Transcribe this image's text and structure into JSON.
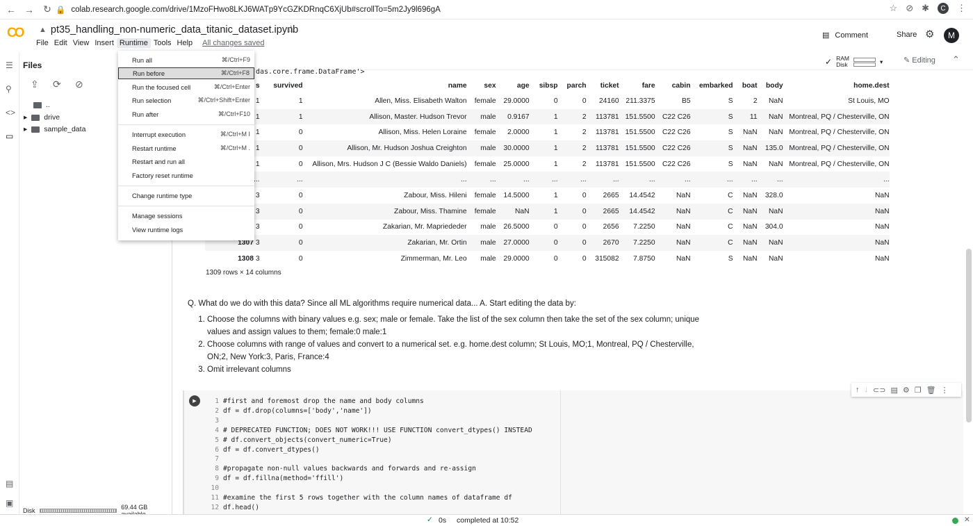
{
  "browser": {
    "url": "colab.research.google.com/drive/1MzoFHwo8LKJ6WATp9YcGZKDRnqC6XjUb#scrollTo=5m2Jy9l696gA",
    "profile_initial": "C"
  },
  "app": {
    "logo": "CO",
    "title": "pt35_handling_non-numeric_data_titanic_dataset.ipynb",
    "menu": [
      "File",
      "Edit",
      "View",
      "Insert",
      "Runtime",
      "Tools",
      "Help"
    ],
    "saved_status": "All changes saved",
    "comment_label": "Comment",
    "share_label": "Share",
    "user_initial": "M"
  },
  "sidebar": {
    "title": "Files",
    "tree": [
      {
        "name": ".."
      },
      {
        "name": "drive"
      },
      {
        "name": "sample_data"
      }
    ],
    "disk_label": "Disk",
    "disk_available": "69.44 GB available"
  },
  "resources": {
    "ram": "RAM",
    "disk": "Disk",
    "mode": "Editing"
  },
  "runtime_menu": [
    {
      "label": "Run all",
      "shortcut": "⌘/Ctrl+F9"
    },
    {
      "label": "Run before",
      "shortcut": "⌘/Ctrl+F8"
    },
    {
      "label": "Run the focused cell",
      "shortcut": "⌘/Ctrl+Enter"
    },
    {
      "label": "Run selection",
      "shortcut": "⌘/Ctrl+Shift+Enter"
    },
    {
      "label": "Run after",
      "shortcut": "⌘/Ctrl+F10"
    },
    {
      "label": "Interrupt execution",
      "shortcut": "⌘/Ctrl+M I"
    },
    {
      "label": "Restart runtime",
      "shortcut": "⌘/Ctrl+M ."
    },
    {
      "label": "Restart and run all",
      "shortcut": ""
    },
    {
      "label": "Factory reset runtime",
      "shortcut": ""
    },
    {
      "label": "Change runtime type",
      "shortcut": ""
    },
    {
      "label": "Manage sessions",
      "shortcut": ""
    },
    {
      "label": "View runtime logs",
      "shortcut": ""
    }
  ],
  "output": {
    "type_line": "das.core.frame.DataFrame'>",
    "columns": [
      "",
      "s",
      "survived",
      "name",
      "sex",
      "age",
      "sibsp",
      "parch",
      "ticket",
      "fare",
      "cabin",
      "embarked",
      "boat",
      "body",
      "home.dest"
    ],
    "rows": [
      [
        "",
        "1",
        "1",
        "Allen, Miss. Elisabeth Walton",
        "female",
        "29.0000",
        "0",
        "0",
        "24160",
        "211.3375",
        "B5",
        "S",
        "2",
        "NaN",
        "St Louis, MO"
      ],
      [
        "",
        "1",
        "1",
        "Allison, Master. Hudson Trevor",
        "male",
        "0.9167",
        "1",
        "2",
        "113781",
        "151.5500",
        "C22 C26",
        "S",
        "11",
        "NaN",
        "Montreal, PQ / Chesterville, ON"
      ],
      [
        "",
        "1",
        "0",
        "Allison, Miss. Helen Loraine",
        "female",
        "2.0000",
        "1",
        "2",
        "113781",
        "151.5500",
        "C22 C26",
        "S",
        "NaN",
        "NaN",
        "Montreal, PQ / Chesterville, ON"
      ],
      [
        "",
        "1",
        "0",
        "Allison, Mr. Hudson Joshua Creighton",
        "male",
        "30.0000",
        "1",
        "2",
        "113781",
        "151.5500",
        "C22 C26",
        "S",
        "NaN",
        "135.0",
        "Montreal, PQ / Chesterville, ON"
      ],
      [
        "",
        "1",
        "0",
        "Allison, Mrs. Hudson J C (Bessie Waldo Daniels)",
        "female",
        "25.0000",
        "1",
        "2",
        "113781",
        "151.5500",
        "C22 C26",
        "S",
        "NaN",
        "NaN",
        "Montreal, PQ / Chesterville, ON"
      ],
      [
        "",
        "...",
        "...",
        "...",
        "...",
        "...",
        "...",
        "...",
        "...",
        "...",
        "...",
        "...",
        "...",
        "...",
        "..."
      ],
      [
        "",
        "3",
        "0",
        "Zabour, Miss. Hileni",
        "female",
        "14.5000",
        "1",
        "0",
        "2665",
        "14.4542",
        "NaN",
        "C",
        "NaN",
        "328.0",
        "NaN"
      ],
      [
        "",
        "3",
        "0",
        "Zabour, Miss. Thamine",
        "female",
        "NaN",
        "1",
        "0",
        "2665",
        "14.4542",
        "NaN",
        "C",
        "NaN",
        "NaN",
        "NaN"
      ],
      [
        "",
        "3",
        "0",
        "Zakarian, Mr. Mapriededer",
        "male",
        "26.5000",
        "0",
        "0",
        "2656",
        "7.2250",
        "NaN",
        "C",
        "NaN",
        "304.0",
        "NaN"
      ],
      [
        "1307",
        "3",
        "0",
        "Zakarian, Mr. Ortin",
        "male",
        "27.0000",
        "0",
        "0",
        "2670",
        "7.2250",
        "NaN",
        "C",
        "NaN",
        "NaN",
        "NaN"
      ],
      [
        "1308",
        "3",
        "0",
        "Zimmerman, Mr. Leo",
        "male",
        "29.0000",
        "0",
        "0",
        "315082",
        "7.8750",
        "NaN",
        "S",
        "NaN",
        "NaN",
        "NaN"
      ]
    ],
    "shape": "1309 rows × 14 columns"
  },
  "markdown": {
    "question": "Q. What do we do with this data? Since all ML algorithms require numerical data... A. Start editing the data by:",
    "items": [
      "Choose the columns with binary values e.g. sex; male or female. Take the list of the sex column then take the set of the sex column; unique values and assign values to them; female:0 male:1",
      "Choose columns with range of values and convert to a numerical set. e.g. home.dest column; St Louis, MO;1, Montreal, PQ / Chesterville, ON;2, New York:3, Paris, France:4",
      "Omit irrelevant columns"
    ]
  },
  "code_cell": {
    "lines": [
      "#first and foremost drop the name and body columns",
      "df = df.drop(columns=['body','name'])",
      "",
      "# DEPRECATED FUNCTION; DOES NOT WORK!!! USE FUNCTION convert_dtypes() INSTEAD",
      "# df.convert_objects(convert_numeric=True)",
      "df = df.convert_dtypes()",
      "",
      "#propagate non-null values backwards and forwards and re-assign",
      "df = df.fillna(method='ffill')",
      "",
      "#examine the first 5 rows together with the column names of dataframe df",
      "df.head()"
    ]
  },
  "status": {
    "time": "0s",
    "message": "completed at 10:52"
  }
}
